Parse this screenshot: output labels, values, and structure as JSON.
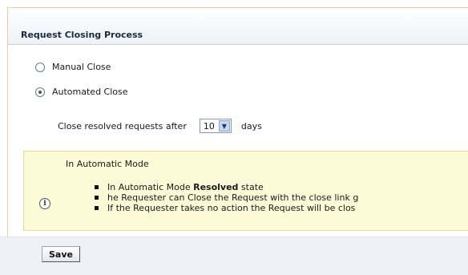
{
  "panel": {
    "title": "Request Closing Process"
  },
  "options": {
    "manual_label": "Manual Close",
    "automated_label": "Automated Close",
    "selected": "automated"
  },
  "close_after": {
    "prefix": "Close resolved requests after",
    "value": "10",
    "suffix": "days"
  },
  "info": {
    "icon": "info-icon",
    "title": "In Automatic Mode",
    "bullet1_prefix": "In Automatic Mode ",
    "bullet1_bold": "Resolved",
    "bullet1_suffix": " state",
    "bullet2": "he Requester can Close the Request with the close link g",
    "bullet3": "If the Requester takes no action the Request will be clos"
  },
  "footer": {
    "save_label": "Save"
  },
  "colors": {
    "accent_border": "#f1c9a3",
    "info_background": "#fdfbd7",
    "footer_background": "#eef1f5"
  }
}
